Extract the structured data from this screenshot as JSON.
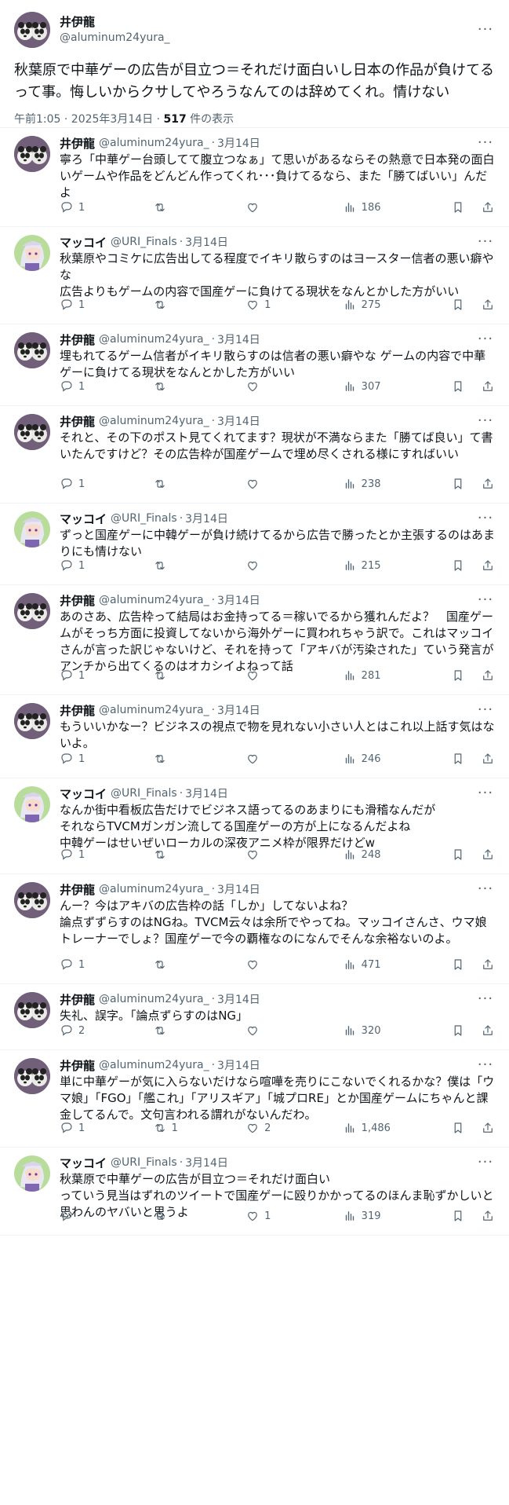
{
  "main": {
    "display_name": "井伊龍",
    "handle": "@aluminum24yura_",
    "text": "秋葉原で中華ゲーの広告が目立つ＝それだけ面白いし日本の作品が負けてるって事。悔しいからクサしてやろうなんてのは辞めてくれ。情けない",
    "timestamp": "午前1:05 · 2025年3月14日 · ",
    "views": "517",
    "views_suffix": " 件の表示",
    "more": "···"
  },
  "replies": [
    {
      "display_name": "井伊龍",
      "handle": "@aluminum24yura_",
      "date": "3月14日",
      "avatar": "panda",
      "text": "寧ろ「中華ゲー台頭してて腹立つなぁ」て思いがあるならその熱意で日本発の面白いゲームや作品をどんどん作ってくれ･･･負けてるなら、また「勝てばいい」んだよ",
      "replies": "1",
      "retweets": "",
      "likes": "",
      "views": "186",
      "more": "···"
    },
    {
      "display_name": "マッコイ",
      "handle": "@URI_Finals",
      "date": "3月14日",
      "avatar": "anime",
      "text": "秋葉原やコミケに広告出してる程度でイキリ散らすのはヨースター信者の悪い癖やな\n広告よりもゲームの内容で国産ゲーに負けてる現状をなんとかした方がいい",
      "replies": "1",
      "retweets": "",
      "likes": "1",
      "views": "275",
      "more": "···"
    },
    {
      "display_name": "井伊龍",
      "handle": "@aluminum24yura_",
      "date": "3月14日",
      "avatar": "panda",
      "text": "埋もれてるゲーム信者がイキリ散らすのは信者の悪い癖やな ゲームの内容で中華ゲーに負けてる現状をなんとかした方がいい",
      "replies": "1",
      "retweets": "",
      "likes": "",
      "views": "307",
      "more": "···"
    },
    {
      "display_name": "井伊龍",
      "handle": "@aluminum24yura_",
      "date": "3月14日",
      "avatar": "panda",
      "text": "それと、その下のポスト見てくれてます？現状が不満ならまた「勝てば良い」て書いたんですけど？その広告枠が国産ゲームで埋め尽くされる様にすればいい",
      "replies": "1",
      "retweets": "",
      "likes": "",
      "views": "238",
      "more": "···"
    },
    {
      "display_name": "マッコイ",
      "handle": "@URI_Finals",
      "date": "3月14日",
      "avatar": "anime",
      "text": "ずっと国産ゲーに中韓ゲーが負け続けてるから広告で勝ったとか主張するのはあまりにも情けない",
      "replies": "1",
      "retweets": "",
      "likes": "",
      "views": "215",
      "more": "···"
    },
    {
      "display_name": "井伊龍",
      "handle": "@aluminum24yura_",
      "date": "3月14日",
      "avatar": "panda",
      "text": "あのさあ、広告枠って結局はお金持ってる＝稼いでるから獲れんだよ？　国産ゲームがそっち方面に投資してないから海外ゲーに買われちゃう訳で。これはマッコイさんが言った訳じゃないけど、それを持って「アキバが汚染された」ていう発言がアンチから出てくるのはオカシイよねって話",
      "replies": "1",
      "retweets": "",
      "likes": "",
      "views": "281",
      "more": "···"
    },
    {
      "display_name": "井伊龍",
      "handle": "@aluminum24yura_",
      "date": "3月14日",
      "avatar": "panda",
      "text": "もういいかなー？ビジネスの視点で物を見れない小さい人とはこれ以上話す気はないよ。",
      "replies": "1",
      "retweets": "",
      "likes": "",
      "views": "246",
      "more": "···"
    },
    {
      "display_name": "マッコイ",
      "handle": "@URI_Finals",
      "date": "3月14日",
      "avatar": "anime",
      "text": "なんか街中看板広告だけでビジネス語ってるのあまりにも滑稽なんだが\nそれならTVCMガンガン流してる国産ゲーの方が上になるんだよね\n中韓ゲーはせいぜいローカルの深夜アニメ枠が限界だけどw",
      "replies": "1",
      "retweets": "",
      "likes": "",
      "views": "248",
      "more": "···"
    },
    {
      "display_name": "井伊龍",
      "handle": "@aluminum24yura_",
      "date": "3月14日",
      "avatar": "panda",
      "text": "んー？今はアキバの広告枠の話「しか」してないよね？\n論点ずずらすのはNGね。TVCM云々は余所でやってね。マッコイさんさ、ウマ娘トレーナーでしょ？国産ゲーで今の覇権なのになんでそんな余裕ないのよ。",
      "replies": "1",
      "retweets": "",
      "likes": "",
      "views": "471",
      "more": "···"
    },
    {
      "display_name": "井伊龍",
      "handle": "@aluminum24yura_",
      "date": "3月14日",
      "avatar": "panda",
      "text": "失礼、誤字。「論点ずらすのはNG」",
      "replies": "2",
      "retweets": "",
      "likes": "",
      "views": "320",
      "more": "···"
    },
    {
      "display_name": "井伊龍",
      "handle": "@aluminum24yura_",
      "date": "3月14日",
      "avatar": "panda",
      "text": "単に中華ゲーが気に入らないだけなら喧嘩を売りにこないでくれるかな？僕は「ウマ娘」「FGO」「艦これ」「アリスギア」「城プロRE」とか国産ゲームにちゃんと課金してるんで。文句言われる謂れがないんだわ。",
      "replies": "1",
      "retweets": "1",
      "likes": "2",
      "views": "1,486",
      "more": "···"
    },
    {
      "display_name": "マッコイ",
      "handle": "@URI_Finals",
      "date": "3月14日",
      "avatar": "anime",
      "text": "秋葉原で中華ゲーの広告が目立つ＝それだけ面白い\nっていう見当はずれのツイートで国産ゲーに殴りかかってるのほんま恥ずかしいと思わんのヤバいと思うよ",
      "replies": "",
      "retweets": "",
      "likes": "1",
      "views": "319",
      "more": "···"
    }
  ],
  "icons": {
    "reply": "speech-bubble-icon",
    "retweet": "retweet-arrows-icon",
    "like": "heart-icon",
    "views": "bar-chart-icon",
    "bookmark": "bookmark-icon",
    "share": "share-upload-icon"
  },
  "colors": {
    "text": "#0f1419",
    "muted": "#536471",
    "divider": "#eff3f4"
  }
}
